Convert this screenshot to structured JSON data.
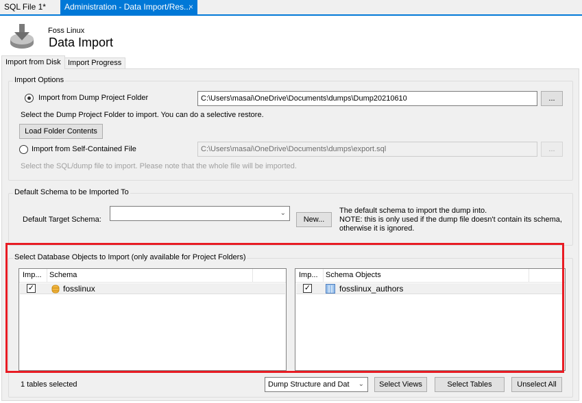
{
  "editor_tabs": [
    {
      "label": "SQL File 1*"
    },
    {
      "label": "Administration - Data Import/Res...",
      "close": "×"
    }
  ],
  "header": {
    "subtitle": "Foss Linux",
    "title": "Data Import",
    "icon": "import-disk-icon"
  },
  "sub_tabs": [
    {
      "label": "Import from Disk",
      "active": true
    },
    {
      "label": "Import Progress"
    }
  ],
  "import_options": {
    "title": "Import Options",
    "dump_folder": {
      "label": "Import from Dump Project Folder",
      "selected": true,
      "path": "C:\\Users\\masai\\OneDrive\\Documents\\dumps\\Dump20210610",
      "browse": "..."
    },
    "dump_hint": "Select the Dump Project Folder to import. You can do a selective restore.",
    "load_button": "Load Folder Contents",
    "self_contained": {
      "label": "Import from Self-Contained File",
      "selected": false,
      "path": "C:\\Users\\masai\\OneDrive\\Documents\\dumps\\export.sql",
      "browse": "..."
    },
    "file_hint": "Select the SQL/dump file to import. Please note that the whole file will be imported."
  },
  "default_schema": {
    "title": "Default Schema to be Imported To",
    "label": "Default Target Schema:",
    "value": "",
    "new_button": "New...",
    "note": [
      "The default schema to import the dump into.",
      "NOTE: this is only used if the dump file doesn't contain its schema,",
      "otherwise it is ignored."
    ]
  },
  "objects": {
    "title": "Select Database Objects to Import (only available for Project Folders)",
    "schema_list": {
      "headers": [
        "Imp...",
        "Schema"
      ],
      "rows": [
        {
          "checked": true,
          "name": "fosslinux"
        }
      ]
    },
    "object_list": {
      "headers": [
        "Imp...",
        "Schema Objects"
      ],
      "rows": [
        {
          "checked": true,
          "name": "fosslinux_authors"
        }
      ]
    },
    "status": "1 tables selected",
    "dump_mode": "Dump Structure and Dat",
    "select_views": "Select Views",
    "select_tables": "Select Tables",
    "unselect_all": "Unselect All"
  },
  "highlight_color": "#e81b23",
  "accent_color": "#0078d7"
}
